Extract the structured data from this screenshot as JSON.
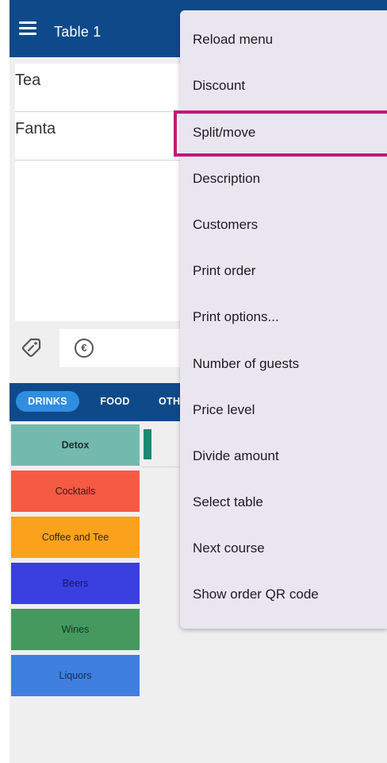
{
  "header": {
    "title": "Table 1",
    "menu_icon": "hamburger-icon"
  },
  "order": {
    "lines": [
      {
        "name": "Tea"
      },
      {
        "name": "Fanta"
      }
    ]
  },
  "actions": {
    "tag_icon": "discount-tag-icon",
    "euro_icon": "€"
  },
  "tabs": [
    {
      "label": "DRINKS",
      "selected": true
    },
    {
      "label": "FOOD",
      "selected": false
    },
    {
      "label": "OTH",
      "selected": false
    }
  ],
  "categories": [
    {
      "label": "Detox",
      "color": "#74b9ad"
    },
    {
      "label": "Cocktails",
      "color": "#f55a43"
    },
    {
      "label": "Coffee and Tee",
      "color": "#fba21c"
    },
    {
      "label": "Beers",
      "color": "#3a3fe0"
    },
    {
      "label": "Wines",
      "color": "#45995f"
    },
    {
      "label": "Liquors",
      "color": "#3f7fe0"
    }
  ],
  "menu": {
    "items": [
      {
        "label": "Reload menu"
      },
      {
        "label": "Discount"
      },
      {
        "label": "Split/move",
        "highlighted": true
      },
      {
        "label": "Description"
      },
      {
        "label": "Customers"
      },
      {
        "label": "Print order"
      },
      {
        "label": "Print options..."
      },
      {
        "label": "Number of guests"
      },
      {
        "label": "Price level"
      },
      {
        "label": "Divide amount"
      },
      {
        "label": "Select table"
      },
      {
        "label": "Next course"
      },
      {
        "label": "Show order QR code"
      }
    ],
    "highlight_color": "#c4177a"
  },
  "colors": {
    "app_bar": "#0e4a8a",
    "selected_tab": "#2f8ee0"
  }
}
